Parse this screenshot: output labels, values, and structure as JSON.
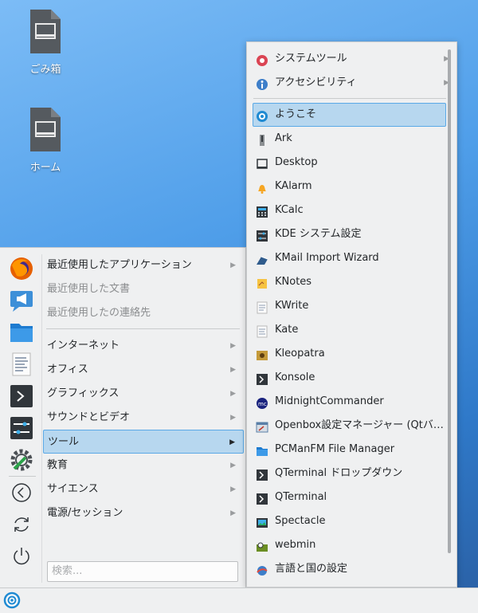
{
  "desktop": {
    "icons": [
      {
        "label": "ごみ箱"
      },
      {
        "label": "ホーム"
      }
    ]
  },
  "main_menu": {
    "categories": [
      {
        "label": "最近使用したアプリケーション",
        "has_submenu": true
      },
      {
        "label": "最近使用した文書",
        "dim": true
      },
      {
        "label": "最近使用したの連絡先",
        "dim": true
      },
      {
        "label": "インターネット",
        "has_submenu": true
      },
      {
        "label": "オフィス",
        "has_submenu": true
      },
      {
        "label": "グラフィックス",
        "has_submenu": true
      },
      {
        "label": "サウンドとビデオ",
        "has_submenu": true
      },
      {
        "label": "ツール",
        "has_submenu": true,
        "selected": true
      },
      {
        "label": "教育",
        "has_submenu": true
      },
      {
        "label": "サイエンス",
        "has_submenu": true
      },
      {
        "label": "電源/セッション",
        "has_submenu": true
      }
    ],
    "search_placeholder": "検索...",
    "favorites": [
      "firefox-icon",
      "announcement-icon",
      "folder-icon",
      "text-editor-icon",
      "terminal-icon",
      "settings-sliders-icon",
      "wrench-gear-icon"
    ],
    "session_buttons": [
      "back-icon",
      "refresh-icon",
      "power-icon"
    ]
  },
  "submenu": {
    "items": [
      {
        "label": "システムツール",
        "icon": "system-tools-icon",
        "has_submenu": true
      },
      {
        "label": "アクセシビリティ",
        "icon": "accessibility-icon",
        "has_submenu": true
      },
      {
        "label": "ようこそ",
        "icon": "welcome-icon",
        "selected": true
      },
      {
        "label": "Ark",
        "icon": "ark-icon"
      },
      {
        "label": "Desktop",
        "icon": "desktop-icon"
      },
      {
        "label": "KAlarm",
        "icon": "bell-icon"
      },
      {
        "label": "KCalc",
        "icon": "calculator-icon"
      },
      {
        "label": "KDE システム設定",
        "icon": "system-settings-icon"
      },
      {
        "label": "KMail Import Wizard",
        "icon": "kmail-import-icon"
      },
      {
        "label": "KNotes",
        "icon": "notes-icon"
      },
      {
        "label": "KWrite",
        "icon": "kwrite-icon"
      },
      {
        "label": "Kate",
        "icon": "kate-icon"
      },
      {
        "label": "Kleopatra",
        "icon": "kleopatra-icon"
      },
      {
        "label": "Konsole",
        "icon": "terminal-icon"
      },
      {
        "label": "MidnightCommander",
        "icon": "midnight-commander-icon"
      },
      {
        "label": "Openbox設定マネージャー (Qtバ…",
        "icon": "openbox-config-icon"
      },
      {
        "label": "PCManFM File Manager",
        "icon": "folder-icon"
      },
      {
        "label": "QTerminal ドロップダウン",
        "icon": "terminal-icon"
      },
      {
        "label": "QTerminal",
        "icon": "terminal-icon"
      },
      {
        "label": "Spectacle",
        "icon": "screenshot-icon"
      },
      {
        "label": "webmin",
        "icon": "webmin-icon"
      },
      {
        "label": "言語と国の設定",
        "icon": "language-settings-icon"
      }
    ]
  },
  "colors": {
    "selection_bg": "#b7d7ef",
    "selection_border": "#5aa9e6",
    "menu_bg": "#eff0f1"
  }
}
